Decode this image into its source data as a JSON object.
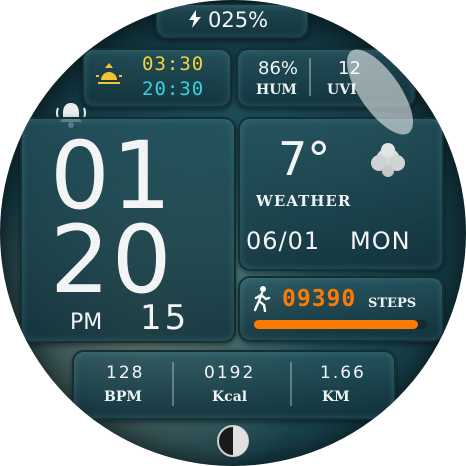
{
  "battery": {
    "value": "025%",
    "icon": "lightning-bolt-icon"
  },
  "sun": {
    "icon": "sunrise-icon",
    "sunrise": "03:30",
    "sunset": "20:30",
    "sunrise_color": "#f4d13a",
    "sunset_color": "#34d4e0"
  },
  "humidity": {
    "value": "86%",
    "label": "HUM"
  },
  "uv": {
    "value": "12",
    "label": "UVI"
  },
  "alarm": {
    "icon": "alarm-bell-icon"
  },
  "time": {
    "hours": "01",
    "minutes": "20",
    "ampm": "PM",
    "seconds": "15"
  },
  "weather": {
    "temp": "7°",
    "label": "WEATHER",
    "icon": "cloud-icon"
  },
  "date": {
    "day_month": "06/01",
    "weekday": "MON"
  },
  "steps": {
    "icon": "walking-person-icon",
    "value": "09390",
    "label": "STEPS",
    "progress": 0.94,
    "accent": "#ff7a00"
  },
  "stats": [
    {
      "value": "128",
      "label": "BPM"
    },
    {
      "value": "0192",
      "label": "Kcal"
    },
    {
      "value": "1.66",
      "label": "KM"
    }
  ],
  "moon": {
    "icon": "moon-phase-icon"
  }
}
